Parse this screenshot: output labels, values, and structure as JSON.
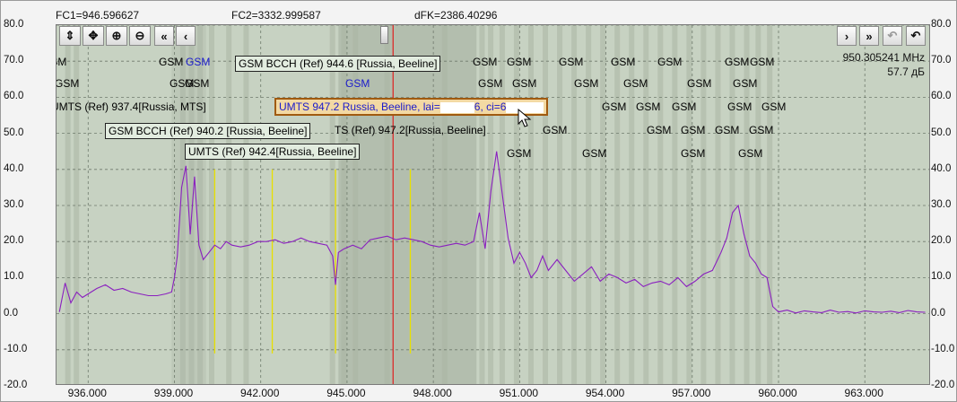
{
  "header": {
    "fc1": "FC1=946.596627",
    "fc2": "FC2=3332.999587",
    "dfk": "dFK=2386.40296"
  },
  "readout": {
    "freq": "950.305241 MHz",
    "level": "57.7 дБ"
  },
  "toolbar": {
    "left_buttons": [
      {
        "name": "fit-vertical-icon",
        "glyph": "⇕"
      },
      {
        "name": "expand-vertical-icon",
        "glyph": "✥"
      },
      {
        "name": "zoom-in-icon",
        "glyph": "⊕"
      },
      {
        "name": "zoom-out-icon",
        "glyph": "⊖"
      },
      {
        "name": "scroll-far-left-icon",
        "glyph": "«"
      },
      {
        "name": "scroll-left-icon",
        "glyph": "‹"
      }
    ],
    "right_buttons": [
      {
        "name": "scroll-right-icon",
        "glyph": "›",
        "disabled": false
      },
      {
        "name": "scroll-far-right-icon",
        "glyph": "»",
        "disabled": false
      },
      {
        "name": "undo-disabled-icon",
        "glyph": "↶",
        "disabled": true
      },
      {
        "name": "undo-icon",
        "glyph": "↶",
        "disabled": false
      }
    ]
  },
  "annotations": {
    "gsm_labels": [
      {
        "text": "GSM",
        "x": 0,
        "y": 0,
        "blue": false
      },
      {
        "text": "GSM",
        "x": 0,
        "y": 0,
        "blue": true
      }
    ],
    "boxes": [
      {
        "text": "GSM BCCH (Ref) 944.6 [Russia, Beeline]"
      },
      {
        "text": "GSM BCCH (Ref) 940.2 [Russia, Beeline]"
      },
      {
        "text": "UMTS (Ref) 942.4[Russia, Beeline]"
      }
    ],
    "highlight": {
      "prefix": "UMTS 947.2 Russia, Beeline, lai=",
      "mid": "6, ci=6"
    },
    "plain": [
      {
        "text": "UMTS (Ref) 937.4[Russia, MTS]"
      },
      {
        "text": "TS (Ref) 947.2[Russia, Beeline]"
      }
    ]
  },
  "chart_data": {
    "type": "line",
    "xlabel": "",
    "ylabel": "",
    "xlim": [
      934.9,
      965.3
    ],
    "ylim": [
      -20,
      80
    ],
    "x_ticks": [
      "936.000",
      "939.000",
      "942.000",
      "945.000",
      "948.000",
      "951.000",
      "954.000",
      "957.000",
      "960.000",
      "963.000"
    ],
    "x_tick_values": [
      936,
      939,
      942,
      945,
      948,
      951,
      954,
      957,
      960,
      963
    ],
    "y_ticks": [
      "80.0",
      "70.0",
      "60.0",
      "50.0",
      "40.0",
      "30.0",
      "20.0",
      "10.0",
      "0.0",
      "-10.0",
      "-20.0"
    ],
    "y_tick_values": [
      80,
      70,
      60,
      50,
      40,
      30,
      20,
      10,
      0,
      -10,
      -20
    ],
    "grid": true,
    "marker_freq": 946.6,
    "umts_channels": [
      937.4,
      942.4,
      947.2
    ],
    "yellow_markers": [
      940.4,
      942.4,
      944.6,
      947.2
    ],
    "series": [
      {
        "color": "#8a1fbf",
        "x": [
          935.0,
          935.2,
          935.4,
          935.6,
          935.8,
          936.0,
          936.3,
          936.6,
          936.9,
          937.2,
          937.5,
          937.8,
          938.1,
          938.4,
          938.7,
          938.9,
          939.0,
          939.1,
          939.25,
          939.4,
          939.55,
          939.7,
          939.85,
          940.0,
          940.2,
          940.4,
          940.6,
          940.8,
          941.0,
          941.3,
          941.6,
          941.9,
          942.2,
          942.5,
          942.8,
          943.1,
          943.4,
          943.7,
          944.0,
          944.3,
          944.5,
          944.6,
          944.7,
          944.9,
          945.2,
          945.5,
          945.8,
          946.1,
          946.4,
          946.7,
          947.0,
          947.3,
          947.6,
          947.9,
          948.2,
          948.5,
          948.8,
          949.1,
          949.4,
          949.6,
          949.8,
          950.0,
          950.2,
          950.4,
          950.6,
          950.8,
          951.0,
          951.2,
          951.4,
          951.6,
          951.8,
          952.0,
          952.3,
          952.6,
          952.9,
          953.2,
          953.5,
          953.8,
          954.1,
          954.4,
          954.7,
          955.0,
          955.3,
          955.6,
          955.9,
          956.2,
          956.5,
          956.8,
          957.1,
          957.4,
          957.7,
          958.0,
          958.2,
          958.4,
          958.6,
          958.8,
          959.0,
          959.2,
          959.4,
          959.6,
          959.8,
          960.0,
          960.3,
          960.6,
          960.9,
          961.2,
          961.5,
          961.8,
          962.1,
          962.4,
          962.7,
          963.0,
          963.3,
          963.6,
          963.9,
          964.2,
          964.5,
          964.8,
          965.1
        ],
        "y": [
          0.5,
          8.5,
          3.0,
          6.0,
          4.5,
          5.5,
          7.0,
          8.0,
          6.5,
          7.0,
          6.0,
          5.5,
          5.0,
          5.0,
          5.5,
          6.0,
          10.0,
          16.0,
          35.0,
          41.0,
          22.0,
          38.0,
          19.0,
          15.0,
          17.0,
          19.0,
          18.0,
          20.0,
          19.0,
          18.5,
          19.0,
          20.0,
          20.0,
          20.5,
          19.5,
          20.0,
          21.0,
          20.0,
          19.5,
          19.0,
          16.0,
          8.0,
          17.0,
          18.0,
          19.0,
          18.0,
          20.5,
          21.0,
          21.5,
          20.5,
          21.0,
          20.5,
          20.0,
          19.0,
          18.5,
          19.0,
          19.5,
          19.0,
          20.0,
          28.0,
          18.0,
          34.0,
          45.0,
          33.0,
          21.0,
          14.0,
          17.0,
          14.0,
          10.0,
          12.0,
          16.0,
          12.0,
          15.0,
          12.0,
          9.0,
          11.0,
          13.0,
          9.0,
          11.0,
          10.0,
          8.5,
          9.5,
          7.5,
          8.5,
          9.0,
          8.0,
          10.0,
          7.5,
          9.0,
          11.0,
          12.0,
          17.0,
          21.0,
          28.0,
          30.0,
          22.0,
          16.0,
          14.0,
          11.0,
          10.0,
          2.0,
          0.5,
          1.0,
          0.2,
          0.8,
          0.5,
          0.3,
          1.0,
          0.4,
          0.6,
          0.2,
          0.8,
          0.5,
          0.4,
          0.7,
          0.3,
          0.9,
          0.5,
          0.4
        ]
      }
    ]
  }
}
